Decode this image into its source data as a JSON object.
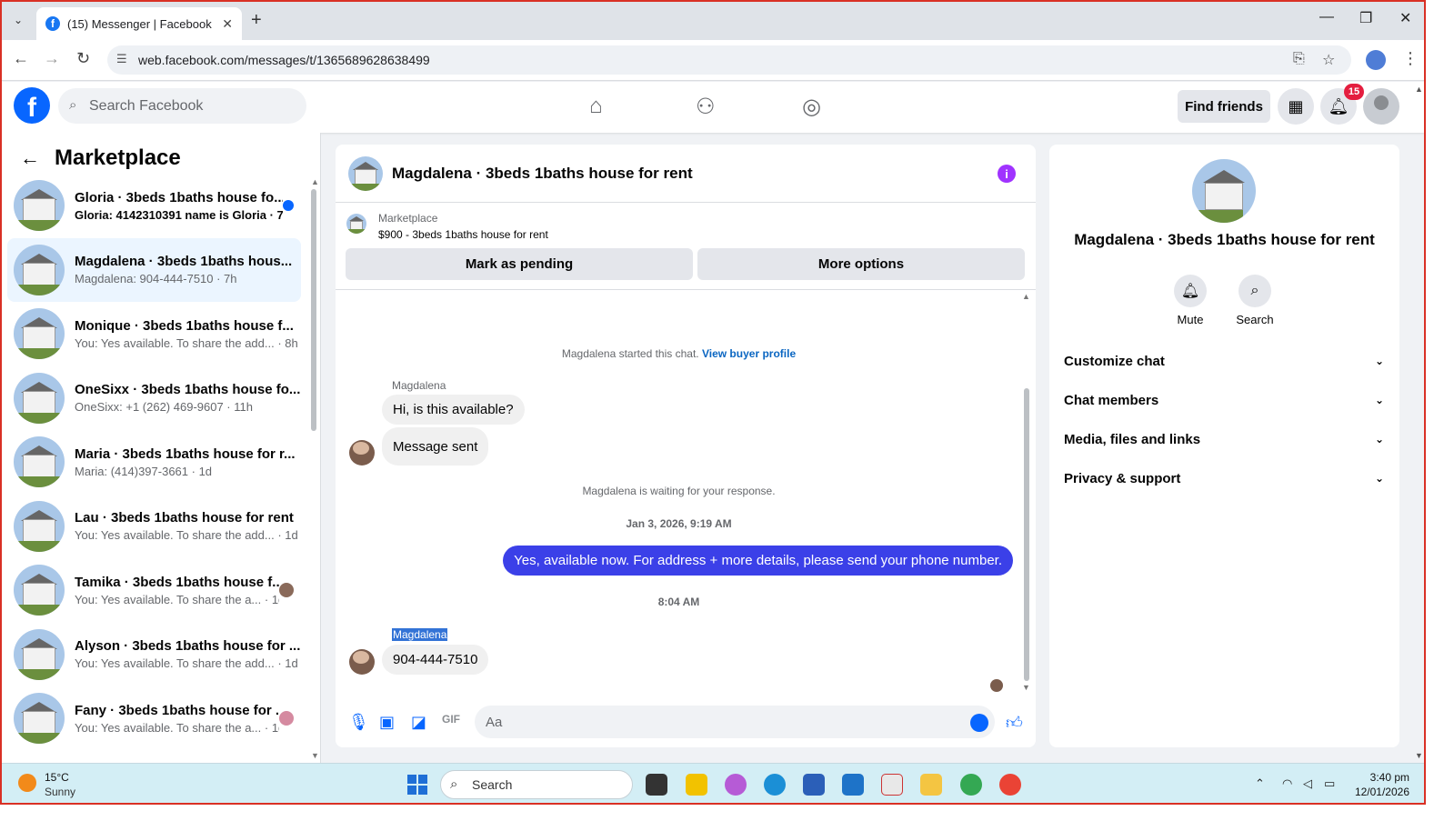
{
  "browser": {
    "tab_title": "(15) Messenger | Facebook",
    "url": "web.facebook.com/messages/t/1365689628638499"
  },
  "fb": {
    "search_placeholder": "Search Facebook",
    "find_friends": "Find friends",
    "notif_count": "15"
  },
  "left": {
    "title": "Marketplace",
    "conversations": [
      {
        "name": "Gloria · 3beds 1baths house fo...",
        "preview": "Gloria: 4142310391 name is Gloria · 7h",
        "unread": true
      },
      {
        "name": "Magdalena · 3beds 1baths hous...",
        "preview": "Magdalena: 904-444-7510 · 7h",
        "active": true
      },
      {
        "name": "Monique · 3beds 1baths house f...",
        "preview": "You: Yes available. To share the add... · 8h"
      },
      {
        "name": "OneSixx · 3beds 1baths house fo...",
        "preview": "OneSixx: +1 (262) 469-9607 · 11h"
      },
      {
        "name": "Maria · 3beds 1baths house for r...",
        "preview": "Maria: (414)397-3661 · 1d"
      },
      {
        "name": "Lau · 3beds 1baths house for rent",
        "preview": "You: Yes available. To share the add... · 1d"
      },
      {
        "name": "Tamika · 3beds 1baths house f...",
        "preview": "You: Yes available. To share the a... · 1d"
      },
      {
        "name": "Alyson · 3beds 1baths house for ...",
        "preview": "You: Yes available. To share the add... · 1d"
      },
      {
        "name": "Fany · 3beds 1baths house for ...",
        "preview": "You: Yes available. To share the a... · 1d"
      }
    ]
  },
  "chat": {
    "title": "Magdalena · 3beds 1baths house for rent",
    "marketplace_label": "Marketplace",
    "listing": "$900 - 3beds 1baths house for rent",
    "mark_pending": "Mark as pending",
    "more_options": "More options",
    "started": "Magdalena started this chat.",
    "view_profile": "View buyer profile",
    "sender": "Magdalena",
    "msg1": "Hi, is this available?",
    "msg2": "Message sent",
    "waiting": "Magdalena is waiting for your response.",
    "date1": "Jan 3, 2026, 9:19 AM",
    "my_msg": "Yes, available now. For address + more details, please send your phone number.",
    "time2": "8:04 AM",
    "msg3": "904-444-7510",
    "input_placeholder": "Aa"
  },
  "right": {
    "name": "Magdalena · 3beds 1baths house for rent",
    "mute": "Mute",
    "search": "Search",
    "sections": [
      "Customize chat",
      "Chat members",
      "Media, files and links",
      "Privacy & support"
    ]
  },
  "taskbar": {
    "temp": "15°C",
    "condition": "Sunny",
    "search": "Search",
    "time": "3:40 pm",
    "date": "12/01/2026"
  }
}
